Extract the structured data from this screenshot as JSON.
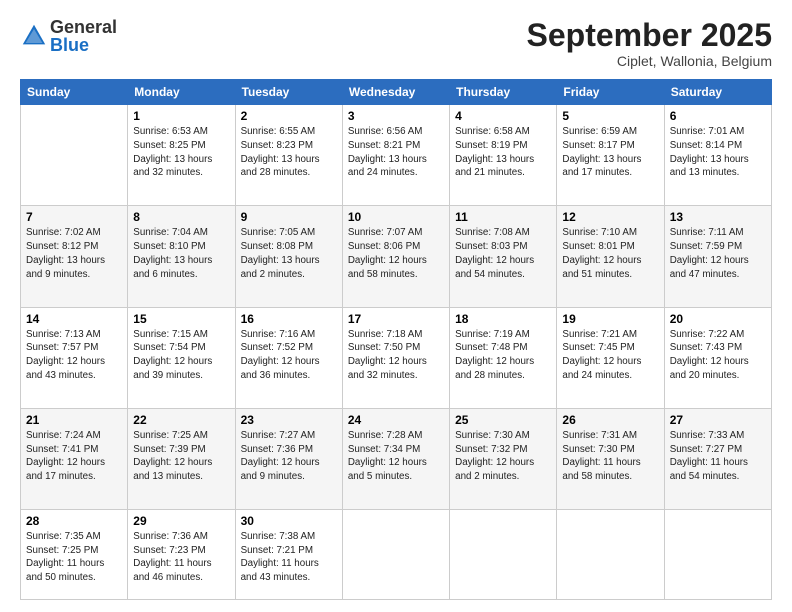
{
  "header": {
    "logo_general": "General",
    "logo_blue": "Blue",
    "month": "September 2025",
    "location": "Ciplet, Wallonia, Belgium"
  },
  "days_of_week": [
    "Sunday",
    "Monday",
    "Tuesday",
    "Wednesday",
    "Thursday",
    "Friday",
    "Saturday"
  ],
  "weeks": [
    [
      {
        "day": "",
        "info": ""
      },
      {
        "day": "1",
        "info": "Sunrise: 6:53 AM\nSunset: 8:25 PM\nDaylight: 13 hours\nand 32 minutes."
      },
      {
        "day": "2",
        "info": "Sunrise: 6:55 AM\nSunset: 8:23 PM\nDaylight: 13 hours\nand 28 minutes."
      },
      {
        "day": "3",
        "info": "Sunrise: 6:56 AM\nSunset: 8:21 PM\nDaylight: 13 hours\nand 24 minutes."
      },
      {
        "day": "4",
        "info": "Sunrise: 6:58 AM\nSunset: 8:19 PM\nDaylight: 13 hours\nand 21 minutes."
      },
      {
        "day": "5",
        "info": "Sunrise: 6:59 AM\nSunset: 8:17 PM\nDaylight: 13 hours\nand 17 minutes."
      },
      {
        "day": "6",
        "info": "Sunrise: 7:01 AM\nSunset: 8:14 PM\nDaylight: 13 hours\nand 13 minutes."
      }
    ],
    [
      {
        "day": "7",
        "info": "Sunrise: 7:02 AM\nSunset: 8:12 PM\nDaylight: 13 hours\nand 9 minutes."
      },
      {
        "day": "8",
        "info": "Sunrise: 7:04 AM\nSunset: 8:10 PM\nDaylight: 13 hours\nand 6 minutes."
      },
      {
        "day": "9",
        "info": "Sunrise: 7:05 AM\nSunset: 8:08 PM\nDaylight: 13 hours\nand 2 minutes."
      },
      {
        "day": "10",
        "info": "Sunrise: 7:07 AM\nSunset: 8:06 PM\nDaylight: 12 hours\nand 58 minutes."
      },
      {
        "day": "11",
        "info": "Sunrise: 7:08 AM\nSunset: 8:03 PM\nDaylight: 12 hours\nand 54 minutes."
      },
      {
        "day": "12",
        "info": "Sunrise: 7:10 AM\nSunset: 8:01 PM\nDaylight: 12 hours\nand 51 minutes."
      },
      {
        "day": "13",
        "info": "Sunrise: 7:11 AM\nSunset: 7:59 PM\nDaylight: 12 hours\nand 47 minutes."
      }
    ],
    [
      {
        "day": "14",
        "info": "Sunrise: 7:13 AM\nSunset: 7:57 PM\nDaylight: 12 hours\nand 43 minutes."
      },
      {
        "day": "15",
        "info": "Sunrise: 7:15 AM\nSunset: 7:54 PM\nDaylight: 12 hours\nand 39 minutes."
      },
      {
        "day": "16",
        "info": "Sunrise: 7:16 AM\nSunset: 7:52 PM\nDaylight: 12 hours\nand 36 minutes."
      },
      {
        "day": "17",
        "info": "Sunrise: 7:18 AM\nSunset: 7:50 PM\nDaylight: 12 hours\nand 32 minutes."
      },
      {
        "day": "18",
        "info": "Sunrise: 7:19 AM\nSunset: 7:48 PM\nDaylight: 12 hours\nand 28 minutes."
      },
      {
        "day": "19",
        "info": "Sunrise: 7:21 AM\nSunset: 7:45 PM\nDaylight: 12 hours\nand 24 minutes."
      },
      {
        "day": "20",
        "info": "Sunrise: 7:22 AM\nSunset: 7:43 PM\nDaylight: 12 hours\nand 20 minutes."
      }
    ],
    [
      {
        "day": "21",
        "info": "Sunrise: 7:24 AM\nSunset: 7:41 PM\nDaylight: 12 hours\nand 17 minutes."
      },
      {
        "day": "22",
        "info": "Sunrise: 7:25 AM\nSunset: 7:39 PM\nDaylight: 12 hours\nand 13 minutes."
      },
      {
        "day": "23",
        "info": "Sunrise: 7:27 AM\nSunset: 7:36 PM\nDaylight: 12 hours\nand 9 minutes."
      },
      {
        "day": "24",
        "info": "Sunrise: 7:28 AM\nSunset: 7:34 PM\nDaylight: 12 hours\nand 5 minutes."
      },
      {
        "day": "25",
        "info": "Sunrise: 7:30 AM\nSunset: 7:32 PM\nDaylight: 12 hours\nand 2 minutes."
      },
      {
        "day": "26",
        "info": "Sunrise: 7:31 AM\nSunset: 7:30 PM\nDaylight: 11 hours\nand 58 minutes."
      },
      {
        "day": "27",
        "info": "Sunrise: 7:33 AM\nSunset: 7:27 PM\nDaylight: 11 hours\nand 54 minutes."
      }
    ],
    [
      {
        "day": "28",
        "info": "Sunrise: 7:35 AM\nSunset: 7:25 PM\nDaylight: 11 hours\nand 50 minutes."
      },
      {
        "day": "29",
        "info": "Sunrise: 7:36 AM\nSunset: 7:23 PM\nDaylight: 11 hours\nand 46 minutes."
      },
      {
        "day": "30",
        "info": "Sunrise: 7:38 AM\nSunset: 7:21 PM\nDaylight: 11 hours\nand 43 minutes."
      },
      {
        "day": "",
        "info": ""
      },
      {
        "day": "",
        "info": ""
      },
      {
        "day": "",
        "info": ""
      },
      {
        "day": "",
        "info": ""
      }
    ]
  ]
}
